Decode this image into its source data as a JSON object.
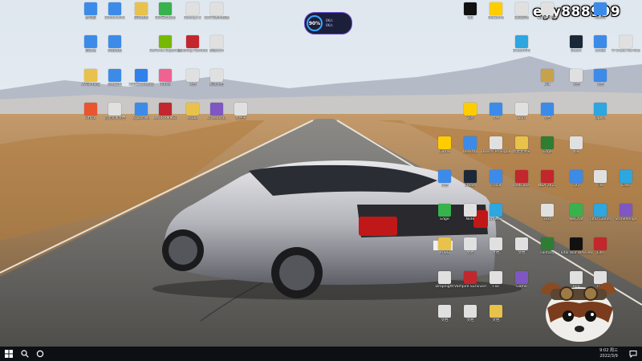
{
  "taskbar": {
    "start_icon": "windows-logo-icon",
    "search_icon": "search-icon",
    "cortana_icon": "circle-icon",
    "time": "9:02 周三",
    "date": "2022/3/9",
    "notification_icon": "chat-bubble-icon"
  },
  "watermark": "eyy888999",
  "widget": {
    "value": "90",
    "unit": "%",
    "up": "0K/s",
    "down": "0K/s"
  },
  "desktop_icons": [
    {
      "label": "此电脑",
      "color": "#3c8be8"
    },
    {
      "label": "Goldenwind",
      "color": "#3c8be8"
    },
    {
      "label": "游戏模板",
      "color": "#e8c24a"
    },
    {
      "label": "360安全卫士",
      "color": "#37b24d"
    },
    {
      "label": "Galaxy1.9",
      "color": "#e0e0e0"
    },
    {
      "label": "公众号素材模板",
      "color": "#e0e0e0"
    },
    {
      "label": "回收站",
      "color": "#3c8be8"
    },
    {
      "label": "网络模板",
      "color": "#3c8be8"
    },
    {
      "label": "GeForce Experience",
      "color": "#76b900"
    },
    {
      "label": "Redshop Remote",
      "color": "#c1272d"
    },
    {
      "label": "新建文本",
      "color": "#e0e0e0"
    },
    {
      "label": "NVIDIA设置",
      "color": "#e8c24a"
    },
    {
      "label": "控制面板",
      "color": "#3c8be8"
    },
    {
      "label": "360安全浏览器",
      "color": "#2f80ed"
    },
    {
      "label": "iTunes",
      "color": "#f06292"
    },
    {
      "label": "文档",
      "color": "#e0e0e0"
    },
    {
      "label": "新建文档",
      "color": "#e0e0e0"
    },
    {
      "label": "Office",
      "color": "#e8552f"
    },
    {
      "label": "新建文本文档",
      "color": "#e0e0e0"
    },
    {
      "label": "AgisoftMe",
      "color": "#3c8be8"
    },
    {
      "label": "WARHAMMER",
      "color": "#c1272d"
    },
    {
      "label": "Adobe",
      "color": "#e8c24a"
    },
    {
      "label": "screenshot",
      "color": "#7e57c2"
    },
    {
      "label": "文件夹",
      "color": "#e0e0e0"
    },
    {
      "label": "QQ",
      "color": "#111111"
    },
    {
      "label": "WeGame",
      "color": "#ffcc00"
    },
    {
      "label": "微软游戏",
      "color": "#e0e0e0"
    },
    {
      "label": "SplitScreen",
      "color": "#e0e0e0"
    },
    {
      "label": "Teams",
      "color": "#3c8be8"
    },
    {
      "label": "DreamPro",
      "color": "#2ea6e0"
    },
    {
      "label": "Steam",
      "color": "#1b2838"
    },
    {
      "label": "文件夹",
      "color": "#3c8be8"
    },
    {
      "label": "Tr Crack Re-Ove",
      "color": "#e0e0e0"
    },
    {
      "label": "LOL",
      "color": "#c8a24a"
    },
    {
      "label": "文档",
      "color": "#e0e0e0"
    },
    {
      "label": "文档",
      "color": "#3c8be8"
    },
    {
      "label": "游戏",
      "color": "#ffcc00"
    },
    {
      "label": "文件",
      "color": "#3c8be8"
    },
    {
      "label": "Word",
      "color": "#e0e0e0"
    },
    {
      "label": "文档",
      "color": "#3c8be8"
    },
    {
      "label": "Opera",
      "color": "#2ea6e0"
    },
    {
      "label": "Game",
      "color": "#ffcc00"
    },
    {
      "label": "Desktop",
      "color": "#3c8be8"
    },
    {
      "label": "Dwarfs Prologue",
      "color": "#e0e0e0"
    },
    {
      "label": "新建文件夹",
      "color": "#e8c24a"
    },
    {
      "label": "Edge",
      "color": "#2e7d32"
    },
    {
      "label": "file",
      "color": "#e0e0e0"
    },
    {
      "label": "文档",
      "color": "#3c8be8"
    },
    {
      "label": "Steam",
      "color": "#1b2838"
    },
    {
      "label": "Cricut",
      "color": "#3c8be8"
    },
    {
      "label": "RedCane",
      "color": "#c1272d"
    },
    {
      "label": "NBA 2K21",
      "color": "#c1272d"
    },
    {
      "label": "QQ",
      "color": "#3c8be8"
    },
    {
      "label": "File",
      "color": "#e0e0e0"
    },
    {
      "label": "Disk",
      "color": "#2ea6e0"
    },
    {
      "label": "Edge",
      "color": "#37b24d"
    },
    {
      "label": "Note",
      "color": "#e0e0e0"
    },
    {
      "label": "Browser",
      "color": "#2ea6e0"
    },
    {
      "label": "Text",
      "color": "#e0e0e0"
    },
    {
      "label": "WeChat",
      "color": "#37b24d"
    },
    {
      "label": "Total Gamer",
      "color": "#2ea6e0"
    },
    {
      "label": "Stonehenge",
      "color": "#7e57c2"
    },
    {
      "label": "PUBG",
      "color": "#e8c24a"
    },
    {
      "label": "文档",
      "color": "#e0e0e0"
    },
    {
      "label": "文档",
      "color": "#e0e0e0"
    },
    {
      "label": "文档",
      "color": "#e0e0e0"
    },
    {
      "label": "Fantasy",
      "color": "#2e7d32"
    },
    {
      "label": "Total War WARHAMMER",
      "color": "#111111"
    },
    {
      "label": "Life",
      "color": "#c1272d"
    },
    {
      "label": "Dropnight",
      "color": "#e0e0e0"
    },
    {
      "label": "Vampire Survivors",
      "color": "#c1272d"
    },
    {
      "label": "Fox",
      "color": "#e0e0e0"
    },
    {
      "label": "Game",
      "color": "#7e57c2"
    },
    {
      "label": "Reli",
      "color": "#e0e0e0"
    },
    {
      "label": "Doc",
      "color": "#e0e0e0"
    },
    {
      "label": "文档",
      "color": "#e0e0e0"
    },
    {
      "label": "文档",
      "color": "#e0e0e0"
    },
    {
      "label": "文档",
      "color": "#e8c24a"
    }
  ]
}
